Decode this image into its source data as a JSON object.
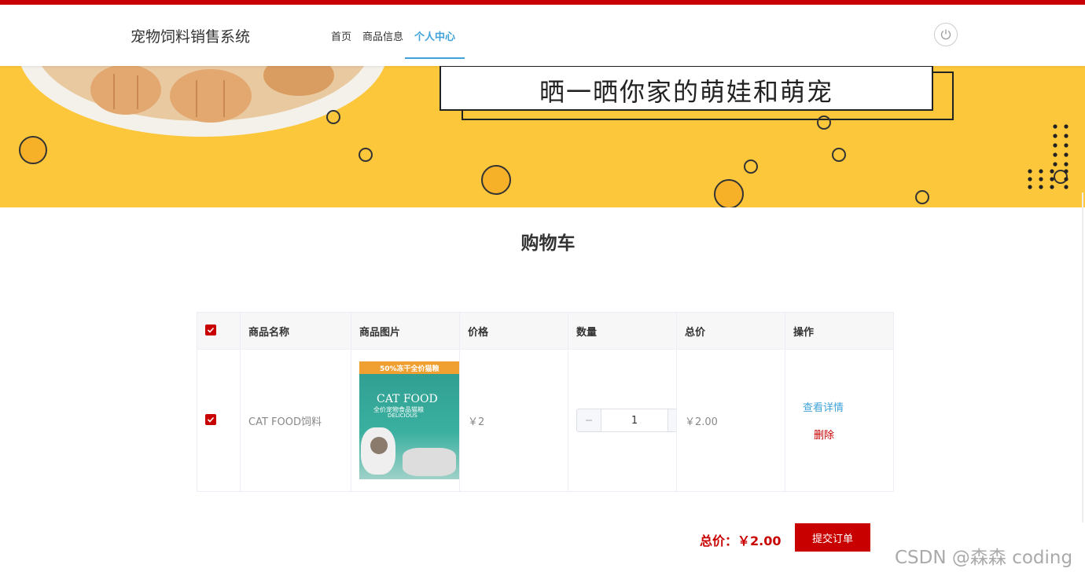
{
  "app": {
    "title": "宠物饲料销售系统"
  },
  "nav": {
    "items": [
      "首页",
      "商品信息",
      "个人中心"
    ],
    "active": "个人中心"
  },
  "banner": {
    "title": "晒一晒你家的萌娃和萌宠"
  },
  "cart": {
    "title": "购物车",
    "headers": [
      "商品名称",
      "商品图片",
      "价格",
      "数量",
      "总价",
      "操作"
    ],
    "rows": [
      {
        "checked": true,
        "name": "CAT FOOD饲料",
        "image": {
          "brand": "CAT FOOD",
          "top_text": "50%冻干全价猫粮",
          "sub": "全价宠物食品猫粮",
          "delicious": "DELICIOUS"
        },
        "price": "￥2",
        "quantity": "1",
        "total": "￥2.00",
        "actions": {
          "detail": "查看详情",
          "delete": "删除"
        }
      }
    ]
  },
  "footer": {
    "total_label": "总价：",
    "total_value": "￥2.00",
    "submit": "提交订单"
  },
  "watermark": "CSDN @森森 coding",
  "colors": {
    "primary": "#c80000",
    "accent": "#3fa3d9",
    "banner": "#fcc73a"
  }
}
